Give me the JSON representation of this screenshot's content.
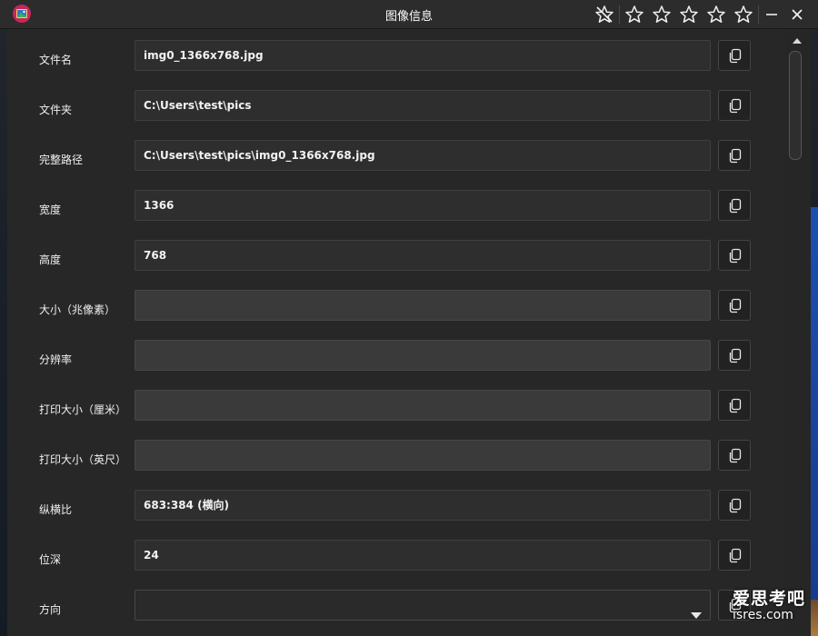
{
  "window": {
    "title": "图像信息",
    "rating_stars": 0,
    "rating_max": 5
  },
  "icons": {
    "app": "image-viewer-app-icon",
    "clear_rating": "star-slash-icon",
    "star": "star-outline-icon",
    "minimize": "minimize-icon",
    "close": "close-icon",
    "copy": "copy-icon",
    "dropdown": "chevron-down-icon",
    "scroll_up": "scroll-up-arrow-icon"
  },
  "colors": {
    "titlebar": "#2c2c2c",
    "panel": "#272727",
    "field": "#2e2e2e",
    "field_empty": "#3a3a3a",
    "app_icon": "#c4285a"
  },
  "fields": [
    {
      "label": "文件名",
      "value": "img0_1366x768.jpg"
    },
    {
      "label": "文件夹",
      "value": "C:\\Users\\test\\pics"
    },
    {
      "label": "完整路径",
      "value": "C:\\Users\\test\\pics\\img0_1366x768.jpg"
    },
    {
      "label": "宽度",
      "value": "1366"
    },
    {
      "label": "高度",
      "value": "768"
    },
    {
      "label": "大小（兆像素）",
      "value": ""
    },
    {
      "label": "分辨率",
      "value": ""
    },
    {
      "label": "打印大小（厘米）",
      "value": ""
    },
    {
      "label": "打印大小（英尺）",
      "value": ""
    },
    {
      "label": "纵横比",
      "value": "683:384 (横向)"
    },
    {
      "label": "位深",
      "value": "24"
    },
    {
      "label": "方向",
      "value": ""
    }
  ],
  "watermark": {
    "line1": "爱思考吧",
    "line2": "isres.com"
  }
}
